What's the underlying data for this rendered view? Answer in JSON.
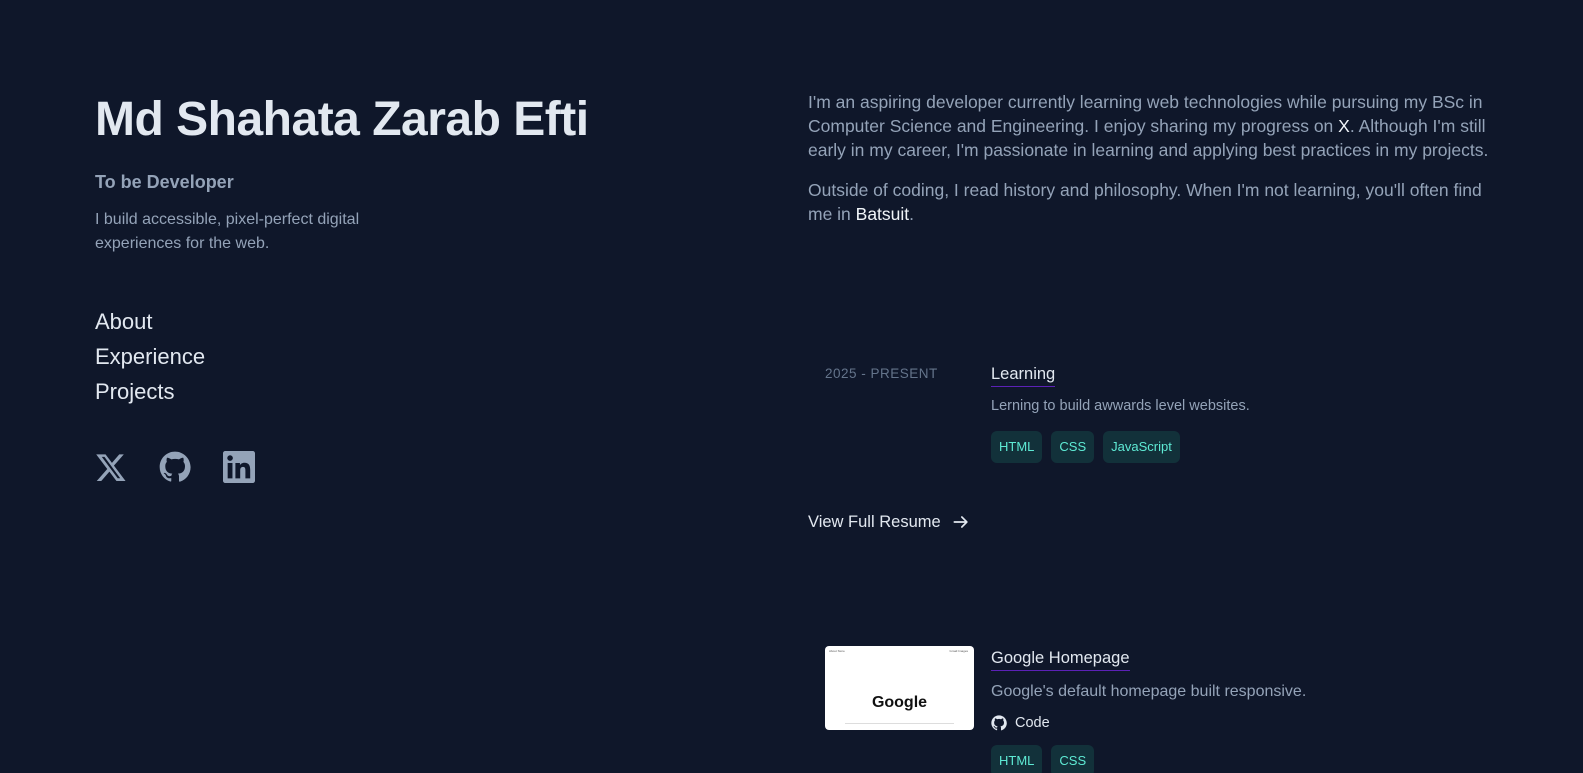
{
  "header": {
    "name": "Md Shahata Zarab Efti",
    "role": "To be Developer",
    "tagline": "I build accessible, pixel-perfect digital experiences for the web."
  },
  "nav": {
    "items": [
      {
        "label": "About"
      },
      {
        "label": "Experience"
      },
      {
        "label": "Projects"
      }
    ]
  },
  "socials": [
    {
      "icon": "x-icon"
    },
    {
      "icon": "github-icon"
    },
    {
      "icon": "linkedin-icon"
    }
  ],
  "about": {
    "p1_before": "I'm an aspiring developer currently learning web technologies while pursuing my BSc in Computer Science and Engineering. I enjoy sharing my progress on ",
    "p1_link": "X",
    "p1_after": ". Although I'm still early in my career, I'm passionate in learning and applying best practices in my projects.",
    "p2_before": "Outside of coding, I read history and philosophy. When I'm not learning, you'll often find me in ",
    "p2_link": "Batsuit",
    "p2_after": "."
  },
  "experience": {
    "date": "2025 - PRESENT",
    "title": "Learning",
    "description": "Lerning to build awwards level websites.",
    "tags": [
      "HTML",
      "CSS",
      "JavaScript"
    ]
  },
  "resume": {
    "label": "View Full Resume"
  },
  "project": {
    "title": "Google Homepage",
    "description": "Google's default homepage built responsive.",
    "code_label": "Code",
    "tags": [
      "HTML",
      "CSS"
    ],
    "thumbnail": {
      "logo_text": "Google",
      "top_left": "About  Store",
      "top_right": "Gmail  Images"
    }
  },
  "colors": {
    "background": "#0f172a",
    "heading": "#e2e8f0",
    "text": "#94a3b8",
    "tag_bg": "#12313a",
    "tag_text": "#5eead4"
  }
}
